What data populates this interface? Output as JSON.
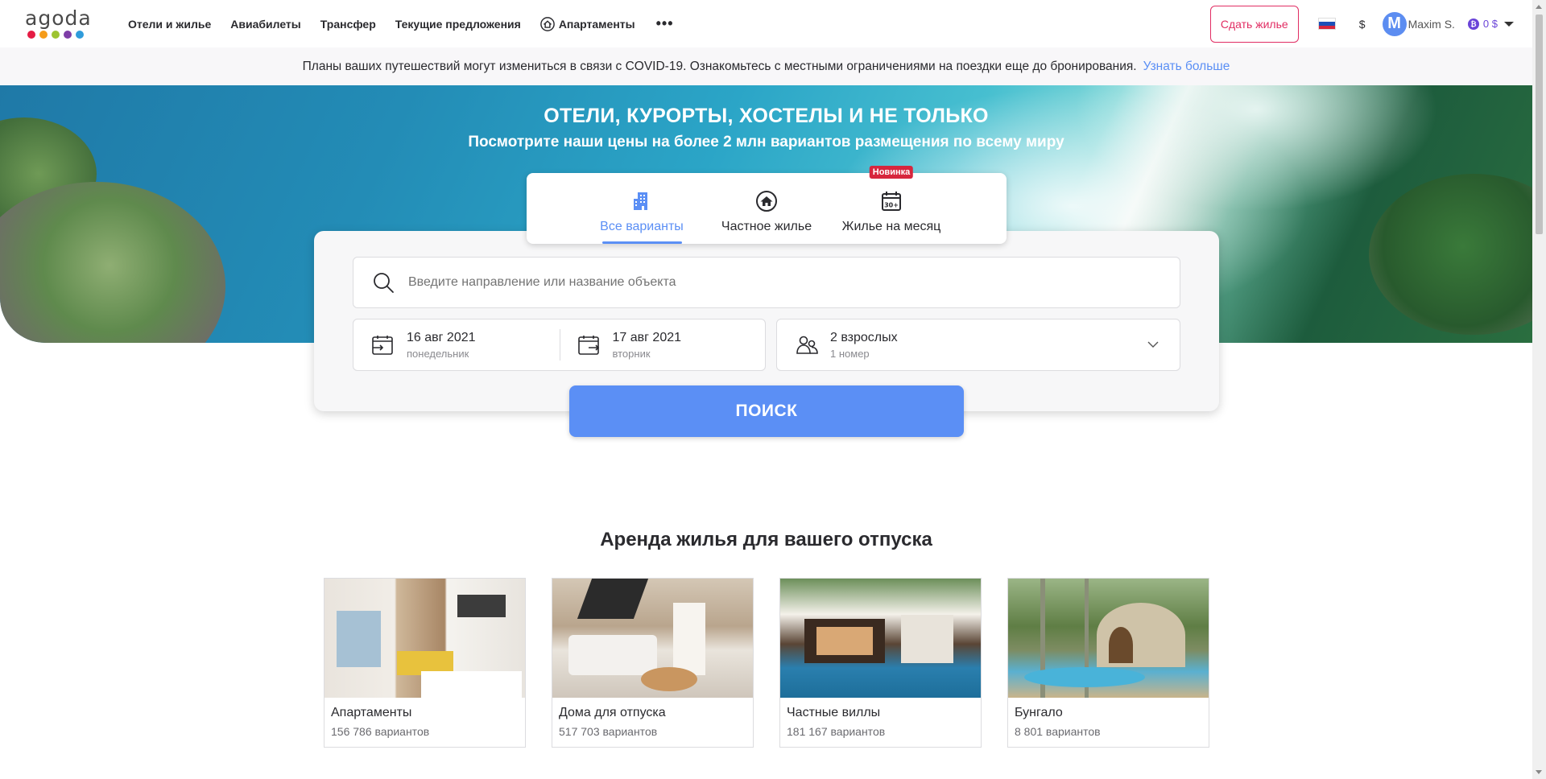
{
  "colors": {
    "accent": "#5b8ff5",
    "host_button": "#e12d63",
    "new_badge": "#d7263d",
    "points": "#6a44d8",
    "logo_dots": [
      "#e51c44",
      "#f59c1a",
      "#9dc431",
      "#7e3da7",
      "#2f9cdb"
    ]
  },
  "header": {
    "logo": "agoda",
    "nav": [
      {
        "label": "Отели и жилье"
      },
      {
        "label": "Авиабилеты"
      },
      {
        "label": "Трансфер"
      },
      {
        "label": "Текущие предложения"
      },
      {
        "label": "Апартаменты",
        "icon": "home-icon"
      }
    ],
    "more_icon": "more-dots-icon",
    "host_button": "Сдать жилье",
    "language_flag": "flag-ru-icon",
    "currency": "$",
    "user": {
      "initial": "M",
      "name": "Maxim S."
    },
    "points": {
      "label": "0 $"
    }
  },
  "banner": {
    "text": "Планы ваших путешествий могут измениться в связи с COVID-19. Ознакомьтесь с местными ограничениями на поездки еще до бронирования.",
    "link": "Узнать больше"
  },
  "hero": {
    "title": "ОТЕЛИ, КУРОРТЫ, ХОСТЕЛЫ И НЕ ТОЛЬКО",
    "subtitle": "Посмотрите наши цены на более 2 млн вариантов размещения по всему миру"
  },
  "tabs": [
    {
      "label": "Все варианты",
      "icon": "building-icon",
      "active": true
    },
    {
      "label": "Частное жилье",
      "icon": "house-icon",
      "active": false
    },
    {
      "label": "Жилье на месяц",
      "icon": "calendar-30-icon",
      "active": false,
      "badge": "Новинка"
    }
  ],
  "search": {
    "destination_placeholder": "Введите направление или название объекта",
    "destination_value": "",
    "checkin": {
      "date": "16 авг 2021",
      "weekday": "понедельник"
    },
    "checkout": {
      "date": "17 авг 2021",
      "weekday": "вторник"
    },
    "guests": {
      "main": "2 взрослых",
      "sub": "1 номер"
    },
    "button": "ПОИСК"
  },
  "section": {
    "title": "Аренда жилья для вашего отпуска",
    "cards": [
      {
        "title": "Апартаменты",
        "count": "156 786 вариантов"
      },
      {
        "title": "Дома для отпуска",
        "count": "517 703 вариантов"
      },
      {
        "title": "Частные виллы",
        "count": "181 167 вариантов"
      },
      {
        "title": "Бунгало",
        "count": "8 801 вариантов"
      }
    ]
  }
}
